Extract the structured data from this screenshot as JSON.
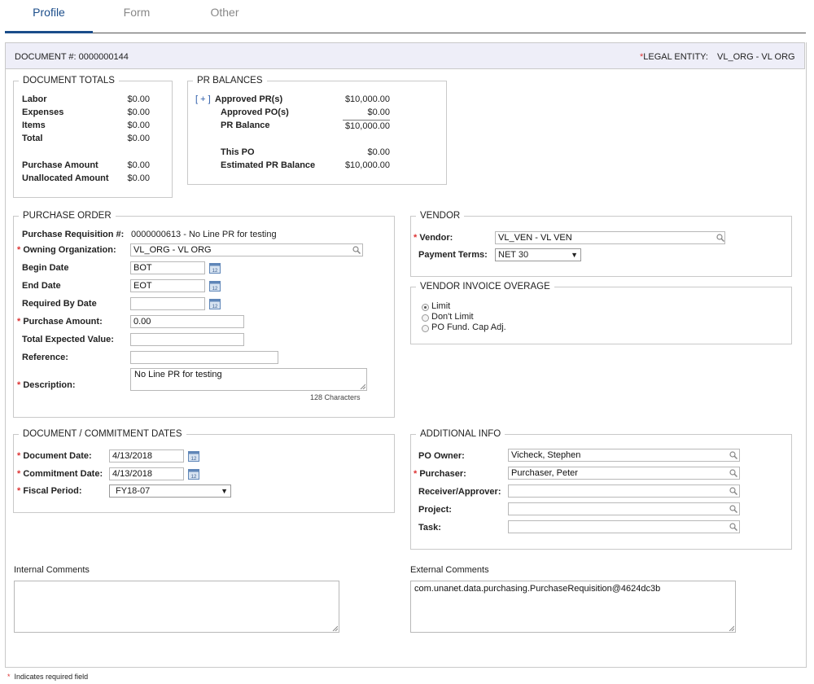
{
  "tabs": [
    {
      "label": "Profile",
      "active": true
    },
    {
      "label": "Form",
      "active": false
    },
    {
      "label": "Other",
      "active": false
    }
  ],
  "header": {
    "document_label": "DOCUMENT #:",
    "document_number": "0000000144",
    "legal_entity_label": "LEGAL ENTITY:",
    "legal_entity_value": "VL_ORG - VL ORG"
  },
  "document_totals": {
    "legend": "DOCUMENT TOTALS",
    "rows": [
      {
        "label": "Labor",
        "value": "$0.00"
      },
      {
        "label": "Expenses",
        "value": "$0.00"
      },
      {
        "label": "Items",
        "value": "$0.00"
      },
      {
        "label": "Total",
        "value": "$0.00"
      },
      {
        "label": "Purchase Amount",
        "value": "$0.00"
      },
      {
        "label": "Unallocated Amount",
        "value": "$0.00"
      }
    ]
  },
  "pr_balances": {
    "legend": "PR BALANCES",
    "expand": "[ + ]",
    "rows": [
      {
        "label": "Approved PR(s)",
        "value": "$10,000.00"
      },
      {
        "label": "Approved PO(s)",
        "value": "$0.00"
      },
      {
        "label": "PR Balance",
        "value": "$10,000.00"
      },
      {
        "label": "This PO",
        "value": "$0.00"
      },
      {
        "label": "Estimated PR Balance",
        "value": "$10,000.00"
      }
    ]
  },
  "purchase_order": {
    "legend": "PURCHASE ORDER",
    "pr_label": "Purchase Requisition #:",
    "pr_value": "0000000613 - No Line PR for testing",
    "owning_org_label": "Owning Organization:",
    "owning_org_value": "VL_ORG - VL ORG",
    "begin_date_label": "Begin Date",
    "begin_date_value": "BOT",
    "end_date_label": "End Date",
    "end_date_value": "EOT",
    "required_by_label": "Required By Date",
    "required_by_value": "",
    "purchase_amount_label": "Purchase Amount:",
    "purchase_amount_value": "0.00",
    "total_expected_label": "Total Expected Value:",
    "total_expected_value": "",
    "reference_label": "Reference:",
    "reference_value": "",
    "description_label": "Description:",
    "description_value": "No Line PR for testing",
    "char_count": "128 Characters"
  },
  "vendor": {
    "legend": "VENDOR",
    "vendor_label": "Vendor:",
    "vendor_value": "VL_VEN - VL VEN",
    "payment_terms_label": "Payment Terms:",
    "payment_terms_value": "NET 30"
  },
  "overage": {
    "legend": "VENDOR INVOICE OVERAGE",
    "options": [
      {
        "label": "Limit",
        "selected": true
      },
      {
        "label": "Don't Limit",
        "selected": false
      },
      {
        "label": "PO Fund. Cap Adj.",
        "selected": false
      }
    ]
  },
  "dates": {
    "legend": "DOCUMENT / COMMITMENT DATES",
    "document_date_label": "Document Date:",
    "document_date_value": "4/13/2018",
    "commitment_date_label": "Commitment Date:",
    "commitment_date_value": "4/13/2018",
    "fiscal_period_label": "Fiscal Period:",
    "fiscal_period_value": "FY18-07"
  },
  "additional": {
    "legend": "ADDITIONAL INFO",
    "po_owner_label": "PO Owner:",
    "po_owner_value": "Vicheck, Stephen",
    "purchaser_label": "Purchaser:",
    "purchaser_value": "Purchaser, Peter",
    "receiver_label": "Receiver/Approver:",
    "receiver_value": "",
    "project_label": "Project:",
    "project_value": "",
    "task_label": "Task:",
    "task_value": ""
  },
  "comments": {
    "internal_label": "Internal Comments",
    "internal_value": "",
    "external_label": "External Comments",
    "external_value": "com.unanet.data.purchasing.PurchaseRequisition@4624dc3b"
  },
  "footer": {
    "required_note": "Indicates required field"
  },
  "colors": {
    "tab_active": "#1b4d8a",
    "header_bg": "#eeeef8",
    "required": "#dd3333"
  },
  "asterisk": "*"
}
